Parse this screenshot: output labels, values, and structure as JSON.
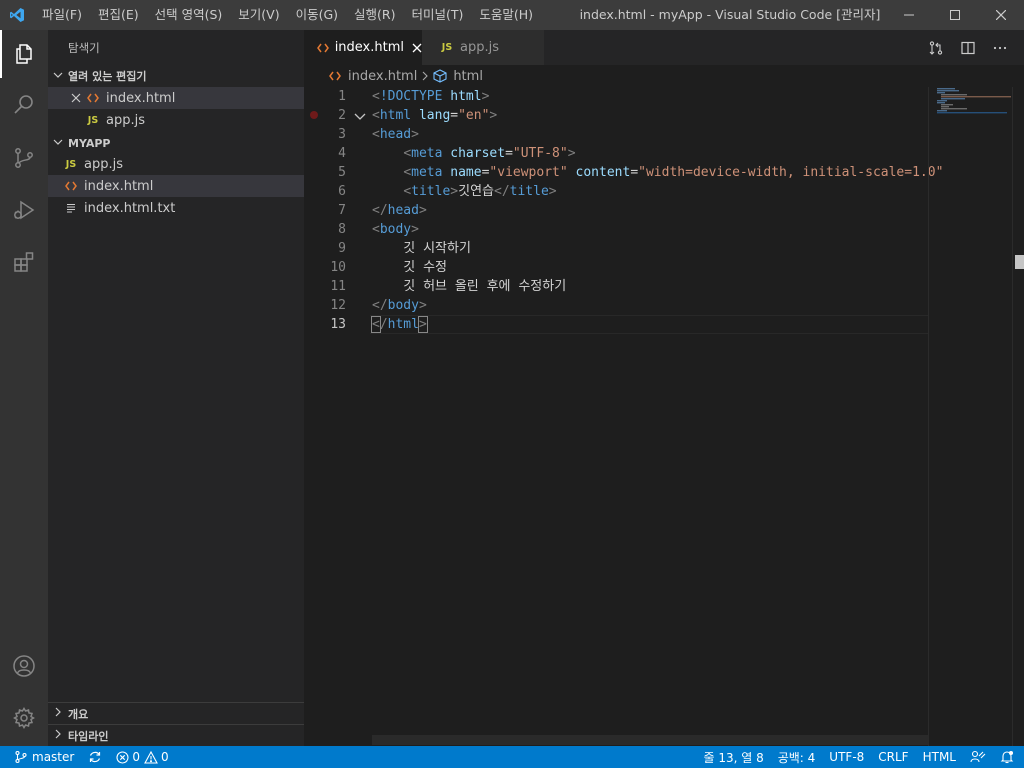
{
  "titlebar": {
    "menus": [
      "파일(F)",
      "편집(E)",
      "선택 영역(S)",
      "보기(V)",
      "이동(G)",
      "실행(R)",
      "터미널(T)",
      "도움말(H)"
    ],
    "title": "index.html - myApp - Visual Studio Code [관리자]"
  },
  "activitybar": {
    "icons": [
      "explorer-icon",
      "search-icon",
      "source-control-icon",
      "run-debug-icon",
      "extensions-icon",
      "account-icon",
      "manage-gear-icon"
    ]
  },
  "sidebar": {
    "title": "탐색기",
    "open_editors": {
      "header": "열려 있는 편집기",
      "files": [
        {
          "name": "index.html",
          "type": "html",
          "icon": "html-icon"
        },
        {
          "name": "app.js",
          "type": "js",
          "icon": "js-icon"
        }
      ]
    },
    "project": {
      "header": "MYAPP",
      "files": [
        {
          "name": "app.js",
          "type": "js",
          "icon": "js-icon"
        },
        {
          "name": "index.html",
          "type": "html",
          "icon": "html-icon"
        },
        {
          "name": "index.html.txt",
          "type": "txt",
          "icon": "text-file-icon"
        }
      ]
    },
    "outline": "개요",
    "timeline": "타임라인"
  },
  "tabs": [
    {
      "label": "index.html",
      "icon_text": "<>"
    },
    {
      "label": "app.js",
      "icon_text": "JS"
    }
  ],
  "breadcrumb": {
    "file": "index.html",
    "symbol": "html"
  },
  "editor": {
    "current_line": 13,
    "lines": [
      {
        "no": "1",
        "segs": [
          [
            "p",
            "<"
          ],
          [
            "t",
            "!DOCTYPE"
          ],
          [
            "x",
            " "
          ],
          [
            "a",
            "html"
          ],
          [
            "p",
            ">"
          ]
        ]
      },
      {
        "no": "2",
        "segs": [
          [
            "p",
            "<"
          ],
          [
            "t",
            "html"
          ],
          [
            "x",
            " "
          ],
          [
            "a",
            "lang"
          ],
          [
            "x",
            "="
          ],
          [
            "s",
            "\"en\""
          ],
          [
            "p",
            ">"
          ]
        ]
      },
      {
        "no": "3",
        "segs": [
          [
            "p",
            "<"
          ],
          [
            "t",
            "head"
          ],
          [
            "p",
            ">"
          ]
        ]
      },
      {
        "no": "4",
        "segs": [
          [
            "x",
            "    "
          ],
          [
            "p",
            "<"
          ],
          [
            "t",
            "meta"
          ],
          [
            "x",
            " "
          ],
          [
            "a",
            "charset"
          ],
          [
            "x",
            "="
          ],
          [
            "s",
            "\"UTF-8\""
          ],
          [
            "p",
            ">"
          ]
        ]
      },
      {
        "no": "5",
        "segs": [
          [
            "x",
            "    "
          ],
          [
            "p",
            "<"
          ],
          [
            "t",
            "meta"
          ],
          [
            "x",
            " "
          ],
          [
            "a",
            "name"
          ],
          [
            "x",
            "="
          ],
          [
            "s",
            "\"viewport\""
          ],
          [
            "x",
            " "
          ],
          [
            "a",
            "content"
          ],
          [
            "x",
            "="
          ],
          [
            "s",
            "\"width=device-width, initial-scale=1.0\""
          ]
        ]
      },
      {
        "no": "6",
        "segs": [
          [
            "x",
            "    "
          ],
          [
            "p",
            "<"
          ],
          [
            "t",
            "title"
          ],
          [
            "p",
            ">"
          ],
          [
            "x",
            "깃연습"
          ],
          [
            "p",
            "</"
          ],
          [
            "t",
            "title"
          ],
          [
            "p",
            ">"
          ]
        ]
      },
      {
        "no": "7",
        "segs": [
          [
            "p",
            "</"
          ],
          [
            "t",
            "head"
          ],
          [
            "p",
            ">"
          ]
        ]
      },
      {
        "no": "8",
        "segs": [
          [
            "p",
            "<"
          ],
          [
            "t",
            "body"
          ],
          [
            "p",
            ">"
          ]
        ]
      },
      {
        "no": "9",
        "segs": [
          [
            "x",
            "    깃 시작하기"
          ]
        ]
      },
      {
        "no": "10",
        "segs": [
          [
            "x",
            "    깃 수정"
          ]
        ]
      },
      {
        "no": "11",
        "segs": [
          [
            "x",
            "    깃 허브 올린 후에 수정하기"
          ]
        ]
      },
      {
        "no": "12",
        "segs": [
          [
            "p",
            "</"
          ],
          [
            "t",
            "body"
          ],
          [
            "p",
            ">"
          ]
        ]
      },
      {
        "no": "13",
        "segs": [
          [
            "b",
            "<"
          ],
          [
            "p",
            "/"
          ],
          [
            "t",
            "html"
          ],
          [
            "b",
            ">"
          ]
        ]
      }
    ]
  },
  "statusbar": {
    "branch": "master",
    "errors": "0",
    "warnings": "0",
    "position": "줄 13, 열 8",
    "spaces": "공백: 4",
    "encoding": "UTF-8",
    "eol": "CRLF",
    "language": "HTML"
  },
  "colors": {
    "accent": "#007acc",
    "titlebar": "#3c3c3c",
    "activitybar": "#333333",
    "sidebar": "#252526",
    "editor": "#1e1e1e"
  }
}
